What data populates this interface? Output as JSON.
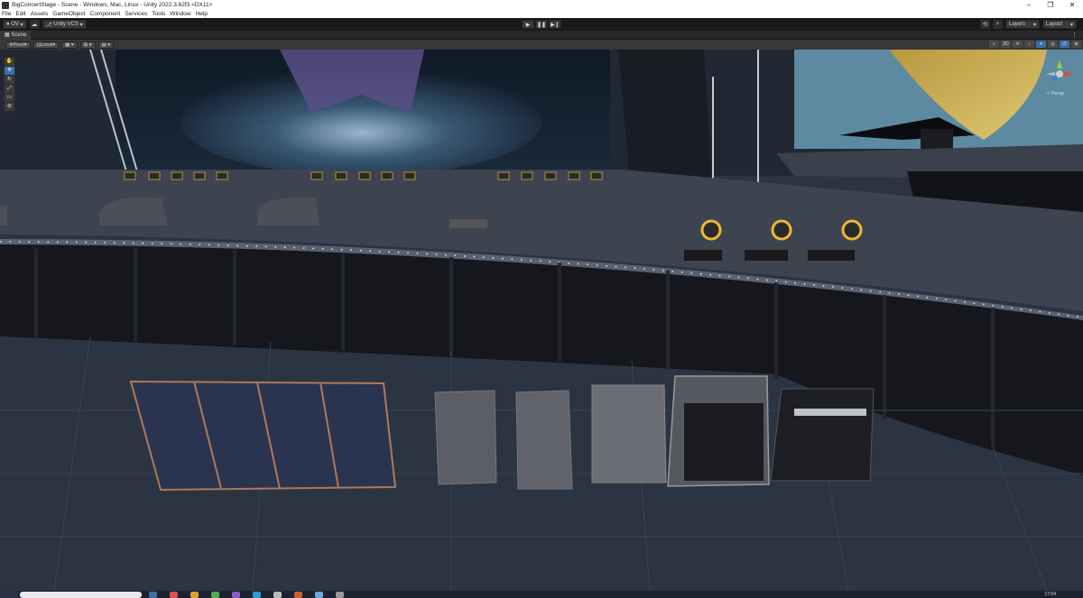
{
  "window": {
    "title": "BigConcertStage - Scene - Windows, Mac, Linux - Unity 2022.3.62f3 <DX11>",
    "minimize_icon": "minimize-icon",
    "maximize_icon": "maximize-icon",
    "close_icon": "close-icon"
  },
  "menu": {
    "items": [
      "File",
      "Edit",
      "Assets",
      "GameObject",
      "Component",
      "Services",
      "Tools",
      "Window",
      "Help"
    ]
  },
  "toolbar": {
    "account_label": "OV",
    "vcs_label": "Unity VCS",
    "play_icon": "play-icon",
    "pause_icon": "pause-icon",
    "step_icon": "step-icon",
    "layers_label": "Layers",
    "layout_label": "Layout"
  },
  "scene_tab": {
    "label": "Scene"
  },
  "scene_options": {
    "pivot_label": "Pivot",
    "local_label": "Local",
    "mode_2d_label": "2D"
  },
  "tools": [
    "hand-tool-icon",
    "move-tool-icon",
    "rotate-tool-icon",
    "scale-tool-icon",
    "rect-tool-icon",
    "transform-tool-icon"
  ],
  "gizmo": {
    "persp_label": "< Persp"
  },
  "taskbar": {
    "clock": "17:04"
  },
  "colors": {
    "accent": "#3b6fa8",
    "floor": "#2b3442",
    "stage_floor": "#3d4450",
    "curtain": "#15171c",
    "led_dot": "#e8eef5"
  }
}
